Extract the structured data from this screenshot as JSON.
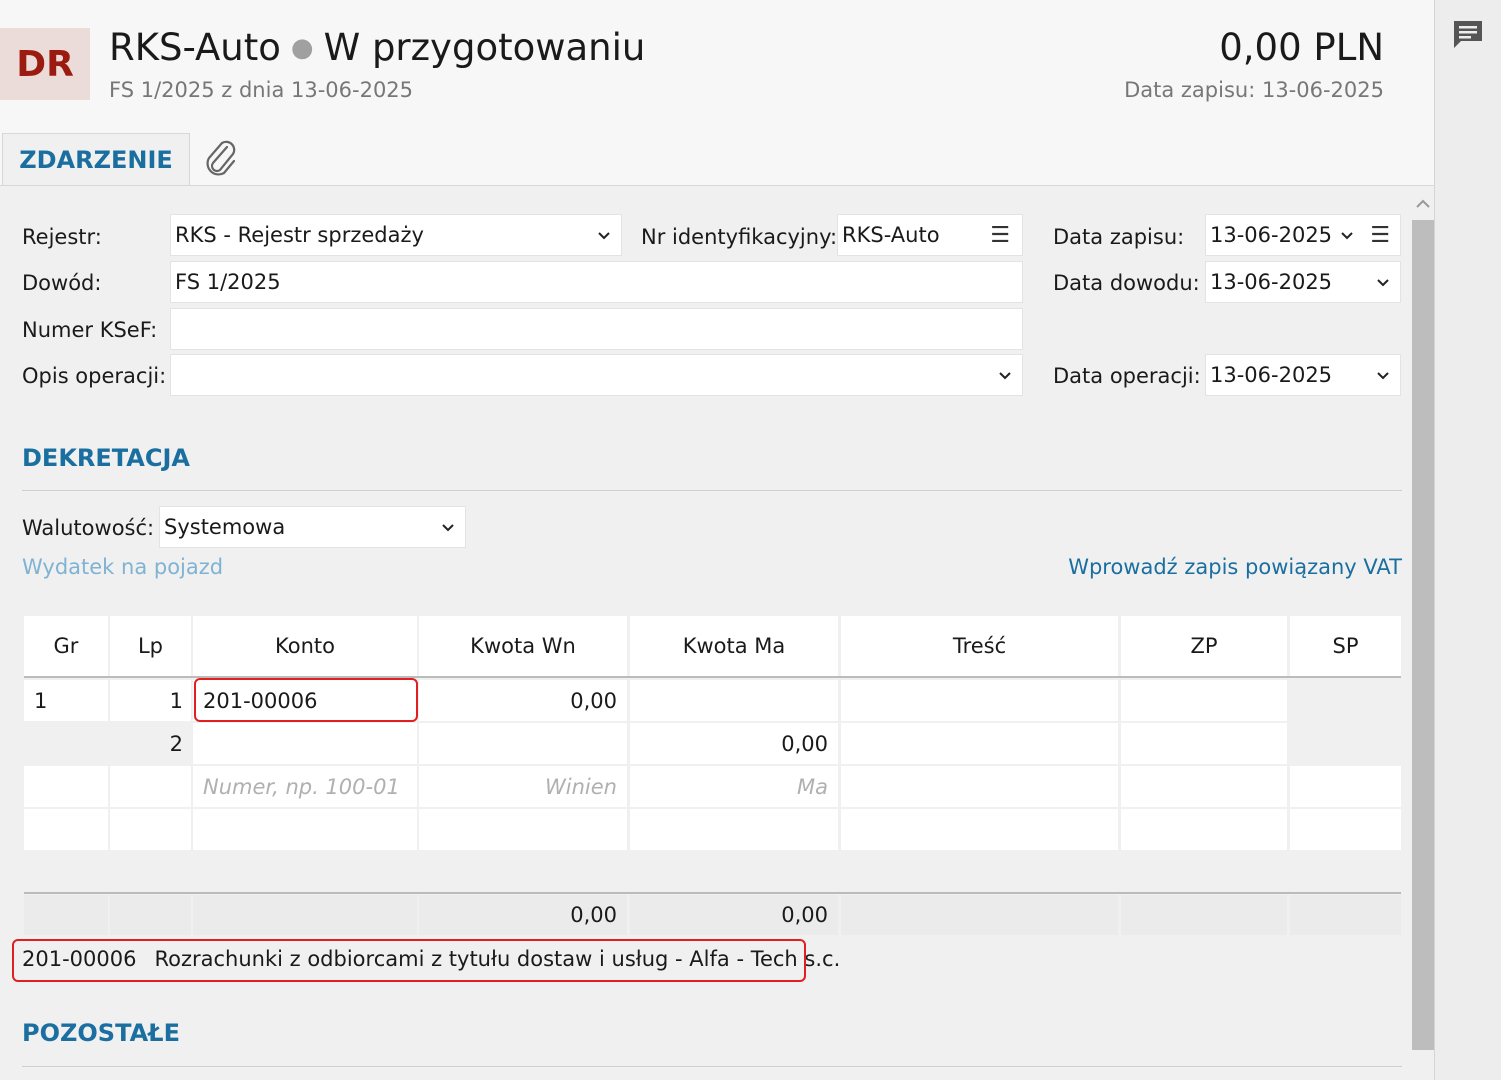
{
  "header": {
    "avatar": "DR",
    "company": "RKS-Auto",
    "status": "W przygotowaniu",
    "subtitle": "FS 1/2025 z dnia 13-06-2025",
    "amount": "0,00 PLN",
    "record_date": "Data zapisu: 13-06-2025"
  },
  "tabs": {
    "active": "ZDARZENIE"
  },
  "form": {
    "rejestr_label": "Rejestr:",
    "rejestr_value": "RKS - Rejestr sprzedaży",
    "nr_id_label": "Nr identyfikacyjny:",
    "nr_id_value": "RKS-Auto",
    "data_zapisu_label": "Data zapisu:",
    "data_zapisu_value": "13-06-2025",
    "dowod_label": "Dowód:",
    "dowod_value": "FS 1/2025",
    "data_dowodu_label": "Data dowodu:",
    "data_dowodu_value": "13-06-2025",
    "ksef_label": "Numer KSeF:",
    "ksef_value": "",
    "opis_label": "Opis operacji:",
    "opis_value": "",
    "data_operacji_label": "Data operacji:",
    "data_operacji_value": "13-06-2025"
  },
  "dekretacja": {
    "title": "DEKRETACJA",
    "walutowosc_label": "Walutowość:",
    "walutowosc_value": "Systemowa",
    "vehicle_link": "Wydatek na pojazd",
    "vat_link": "Wprowadź zapis powiązany VAT",
    "columns": [
      "Gr",
      "Lp",
      "Konto",
      "Kwota Wn",
      "Kwota Ma",
      "Treść",
      "ZP",
      "SP"
    ],
    "rows": [
      {
        "gr": "1",
        "lp": "1",
        "konto": "201-00006",
        "wn": "0,00",
        "ma": ""
      },
      {
        "gr": "",
        "lp": "2",
        "konto": "",
        "wn": "",
        "ma": "0,00"
      }
    ],
    "placeholders": {
      "konto": "Numer, np. 100-01",
      "wn": "Winien",
      "ma": "Ma"
    },
    "totals": {
      "wn": "0,00",
      "ma": "0,00"
    },
    "account_info_code": "201-00006",
    "account_info_desc": "Rozrachunki z odbiorcami z tytułu dostaw i usług - Alfa - Tech s.c."
  },
  "pozostale": {
    "title": "POZOSTAŁE"
  },
  "colors": {
    "accent": "#1a6fa0",
    "highlight": "#e02020",
    "link_light": "#7fb3d3"
  }
}
